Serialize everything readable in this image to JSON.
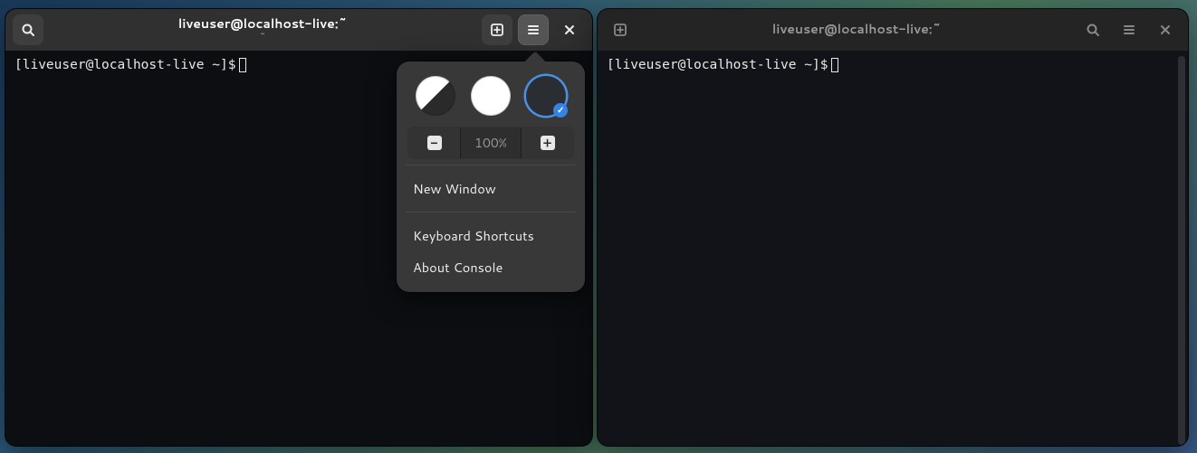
{
  "windows": {
    "left": {
      "title": "liveuser@localhost-live:~",
      "subtitle": "~",
      "prompt": "[liveuser@localhost-live ~]$"
    },
    "right": {
      "title": "liveuser@localhost-live:~",
      "prompt": "[liveuser@localhost-live ~]$"
    }
  },
  "popover": {
    "themes": {
      "system": "system-theme",
      "light": "light-theme",
      "dark": "dark-theme",
      "selected": "dark"
    },
    "zoom": {
      "minus": "−",
      "level": "100%",
      "plus": "+"
    },
    "items": {
      "new_window": "New Window",
      "keyboard_shortcuts": "Keyboard Shortcuts",
      "about": "About Console"
    }
  },
  "icons": {
    "search": "search-icon",
    "new_tab": "new-tab-icon",
    "hamburger": "hamburger-icon",
    "close": "close-icon",
    "check": "✓"
  }
}
